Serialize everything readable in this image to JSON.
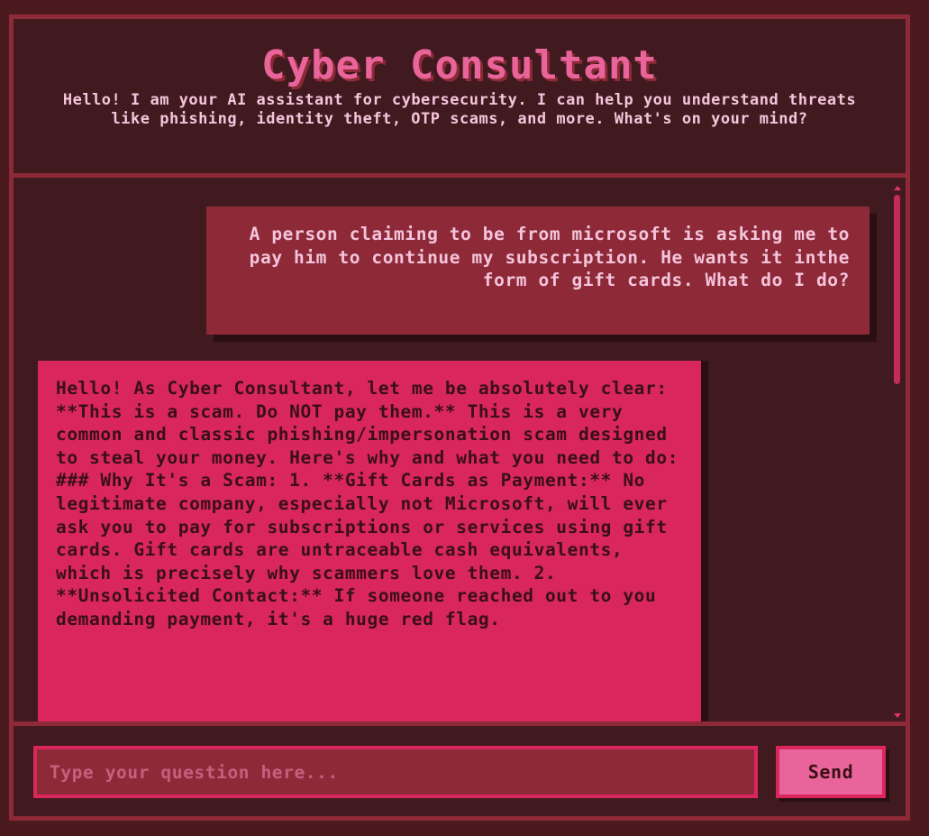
{
  "header": {
    "title": "Cyber Consultant",
    "subtitle": "Hello! I am your AI assistant for cybersecurity. I can help you understand threats like phishing, identity theft, OTP scams, and more. What's on your mind?"
  },
  "messages": [
    {
      "role": "user",
      "text": "A person claiming to be from microsoft is asking me to pay him to continue my subscription. He wants it inthe form of gift cards. What do I do?"
    },
    {
      "role": "assistant",
      "text": "Hello! As Cyber Consultant, let me be absolutely clear: **This is a scam. Do NOT pay them.** This is a very common and classic phishing/impersonation scam designed to steal your money. Here's why and what you need to do: ### Why It's a Scam: 1. **Gift Cards as Payment:** No legitimate company, especially not Microsoft, will ever ask you to pay for subscriptions or services using gift cards. Gift cards are untraceable cash equivalents, which is precisely why scammers love them. 2. **Unsolicited Contact:** If someone reached out to you demanding payment, it's a huge red flag."
    }
  ],
  "input": {
    "placeholder": "Type your question here...",
    "value": ""
  },
  "send_button": {
    "label": "Send"
  },
  "colors": {
    "background": "#401a1e",
    "border": "#8e2a38",
    "accent": "#d9275e",
    "title": "#e8649a"
  }
}
